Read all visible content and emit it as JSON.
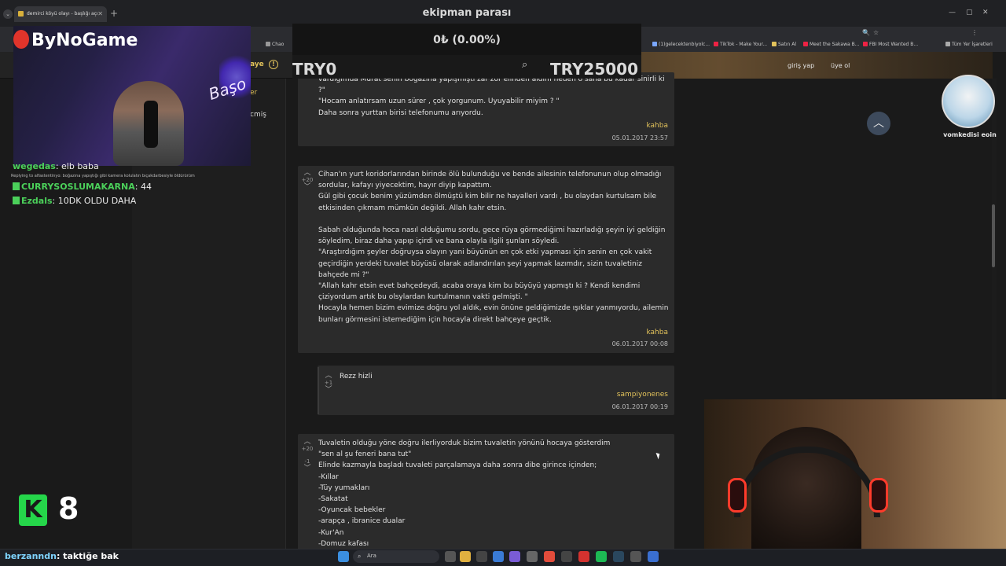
{
  "browser": {
    "tab_title": "demirci köyü olayı - başlığı açı",
    "new_tab_icon": "plus-icon",
    "bookmarks": [
      "Chao",
      "(1)gelecektenbiyolc...",
      "TikTok - Make Your...",
      "Satın Al",
      "Meet the Sakawa B...",
      "FBI Most Wanted B...",
      "Tüm Yer İşaretleri"
    ]
  },
  "header": {
    "logo_fragment": "aye",
    "nav_item": "ara",
    "login": "giriş yap",
    "signup": "üye ol"
  },
  "left_nav": {
    "active_fragment": "er",
    "item_fragment": "cmiş"
  },
  "entries": [
    {
      "lines": "vardığımda Murat senin boğazına yapışmıştı zar zor elinden aldım neden o sana bu kadar sinirli ki\n?\"\n\"Hocam anlatırsam uzun sürer , çok yorgunum. Uyuyabilir miyim ? \"\nDaha sonra yurttan birisi telefonumu arıyordu.",
      "author": "kahba",
      "timestamp": "05.01.2017 23:57"
    },
    {
      "votes": "+20",
      "lines": "Cihan'ın yurt koridorlarından birinde ölü bulunduğu ve bende ailesinin telefonunun olup olmadığı\nsordular, kafayı yiyecektim, hayır diyip kapattım.\nGül gibi çocuk benim yüzümden ölmüştü kim bilir ne hayalleri vardı , bu olaydan kurtulsam bile\netkisinden çıkmam mümkün değildi. Allah kahr etsin.\n\nSabah olduğunda hoca nasıl olduğumu sordu, gece rüya görmediğimi hazırladığı şeyin iyi geldiğin\nsöyledim, biraz daha yapıp içirdi ve bana olayla ilgili şunları söyledi.\n\"Araştırdığım şeyler doğruysa olayın yani büyünün en çok etki yapması için senin en çok vakit\ngeçirdiğin yerdeki tuvalet büyüsü olarak adlandırılan şeyi yapmak lazımdır, sizin tuvaletiniz\nbahçede mi ?\"\n\"Allah kahr etsin evet bahçedeydi, acaba oraya kim bu büyüyü yapmıştı ki ? Kendi kendimi\nçiziyordum artık bu olsylardan kurtulmanın vakti gelmişti. \"\nHocayla hemen bizim evimize doğru yol aldık, evin önüne geldiğimizde ışıklar yanmıyordu, ailemin\nbunları görmesini istemediğim için hocayla direkt bahçeye geçtik.",
      "author": "kahba",
      "timestamp": "06.01.2017 00:08"
    },
    {
      "votes": "+1",
      "lines": "Rezz hizli",
      "author": "sampiyonenes",
      "timestamp": "06.01.2017 00:19"
    },
    {
      "votes": "+20",
      "votes_down": "-1",
      "lines": "Tuvaletin olduğu yöne doğru ilerliyorduk bizim tuvaletin yönünü hocaya gösterdim\n\"sen al şu feneri bana tut\"\nElinde kazmayla başladı tuvaleti parçalamaya daha sonra dibe girince içinden;\n-Kıllar\n-Tüy yumakları\n-Sakatat\n-Oyuncak bebekler\n-arapça , ibranice dualar\n-Kur'An\n-Domuz kafası"
    }
  ],
  "overlay": {
    "brand": "ByNoGame",
    "neon_sign": "Başo",
    "dollar_title": "ekipman parası",
    "dollar_amount": "0₺ (0.00%)",
    "dollar_min": "TRY0",
    "dollar_max": "TRY25000",
    "chat": [
      {
        "user": "wegedas",
        "text": "elb baba"
      },
      {
        "user": "CURRYSOSLUMAKARNA",
        "text": "44"
      },
      {
        "user": "Ezdals",
        "text": "10DK OLDU DAHA"
      }
    ],
    "reply_context": "Replying to  alfastentinyo: boğazına yapıştığı gibi kamera kolulatın bıçakdarbesiyle öldürürüm",
    "k_count": "8",
    "bottom_user": "berzanndn",
    "bottom_text": ": taktiğe bak",
    "avatar_name": "vomkedisi eoin"
  },
  "taskbar": {
    "search_placeholder": "Ara"
  }
}
